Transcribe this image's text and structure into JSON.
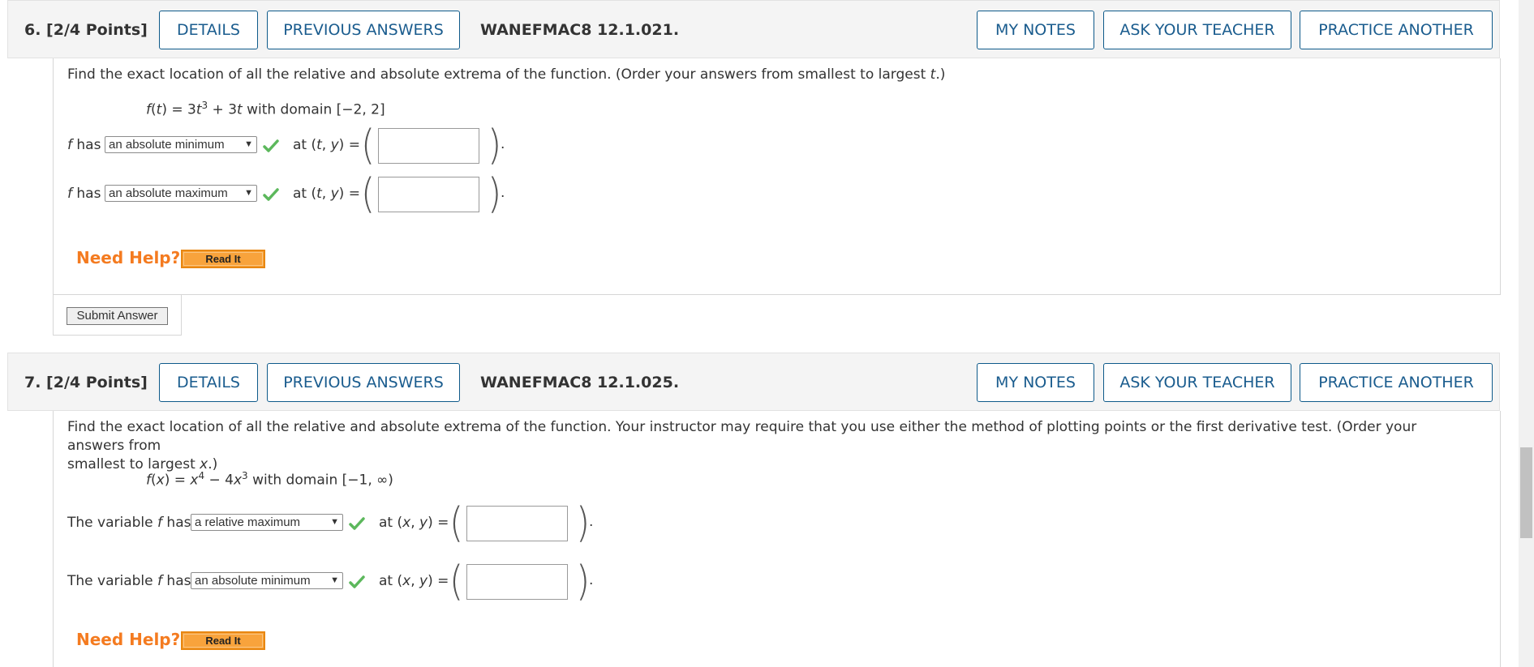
{
  "questions": [
    {
      "number_label": "6.  [2/4 Points]",
      "details": "DETAILS",
      "previous_answers": "PREVIOUS ANSWERS",
      "code": "WANEFMAC8 12.1.021.",
      "my_notes": "MY NOTES",
      "ask_teacher": "ASK YOUR TEACHER",
      "practice_another": "PRACTICE ANOTHER",
      "prompt_pre": "Find the exact location of all the relative and absolute extrema of the function. (Order your answers from smallest to largest ",
      "prompt_var": "t",
      "prompt_post": ".)",
      "formula": {
        "fn": "f",
        "var": "t",
        "eq": " = 3",
        "v1": "t",
        "exp1": "3",
        "mid": " + 3",
        "v2": "t",
        "domain": " with domain [−2, 2]"
      },
      "rows": [
        {
          "prefix": "f",
          "has": " has",
          "selected": "an absolute minimum",
          "at": "at (",
          "var1": "t",
          "sep": ", ",
          "var2": "y",
          "close": ") =",
          "answer": "",
          "dot": "."
        },
        {
          "prefix": "f",
          "has": " has",
          "selected": "an absolute maximum",
          "at": "at (",
          "var1": "t",
          "sep": ", ",
          "var2": "y",
          "close": ") =",
          "answer": "",
          "dot": "."
        }
      ],
      "need_help": "Need Help?",
      "read_it": "Read It",
      "submit": "Submit Answer"
    },
    {
      "number_label": "7.  [2/4 Points]",
      "details": "DETAILS",
      "previous_answers": "PREVIOUS ANSWERS",
      "code": "WANEFMAC8 12.1.025.",
      "my_notes": "MY NOTES",
      "ask_teacher": "ASK YOUR TEACHER",
      "practice_another": "PRACTICE ANOTHER",
      "prompt_line1": "Find the exact location of all the relative and absolute extrema of the function. Your instructor may require that you use either the method of plotting points or the first derivative test. (Order your answers from",
      "prompt_line2_pre": "smallest to largest ",
      "prompt_var": "x",
      "prompt_post": ".)",
      "formula": {
        "fn": "f",
        "var": "x",
        "eq": " = ",
        "v1": "x",
        "exp1": "4",
        "mid": " − 4",
        "v2": "x",
        "exp2": "3",
        "domain": " with domain [−1, ∞)"
      },
      "rows": [
        {
          "pre": "The variable ",
          "prefix": "f",
          "has": " has",
          "selected": "a relative maximum",
          "at": "at (",
          "var1": "x",
          "sep": ", ",
          "var2": "y",
          "close": ") =",
          "answer": "",
          "dot": "."
        },
        {
          "pre": "The variable ",
          "prefix": "f",
          "has": " has",
          "selected": "an absolute minimum",
          "at": "at (",
          "var1": "x",
          "sep": ", ",
          "var2": "y",
          "close": ") =",
          "answer": "",
          "dot": "."
        }
      ],
      "need_help": "Need Help?",
      "read_it": "Read It"
    }
  ],
  "colors": {
    "accent": "#1a5c8e",
    "help": "#f47b20",
    "check": "#5cb85c"
  },
  "icons": {
    "status": "green-checkmark-icon",
    "dropdown": "chevron-down-icon"
  }
}
